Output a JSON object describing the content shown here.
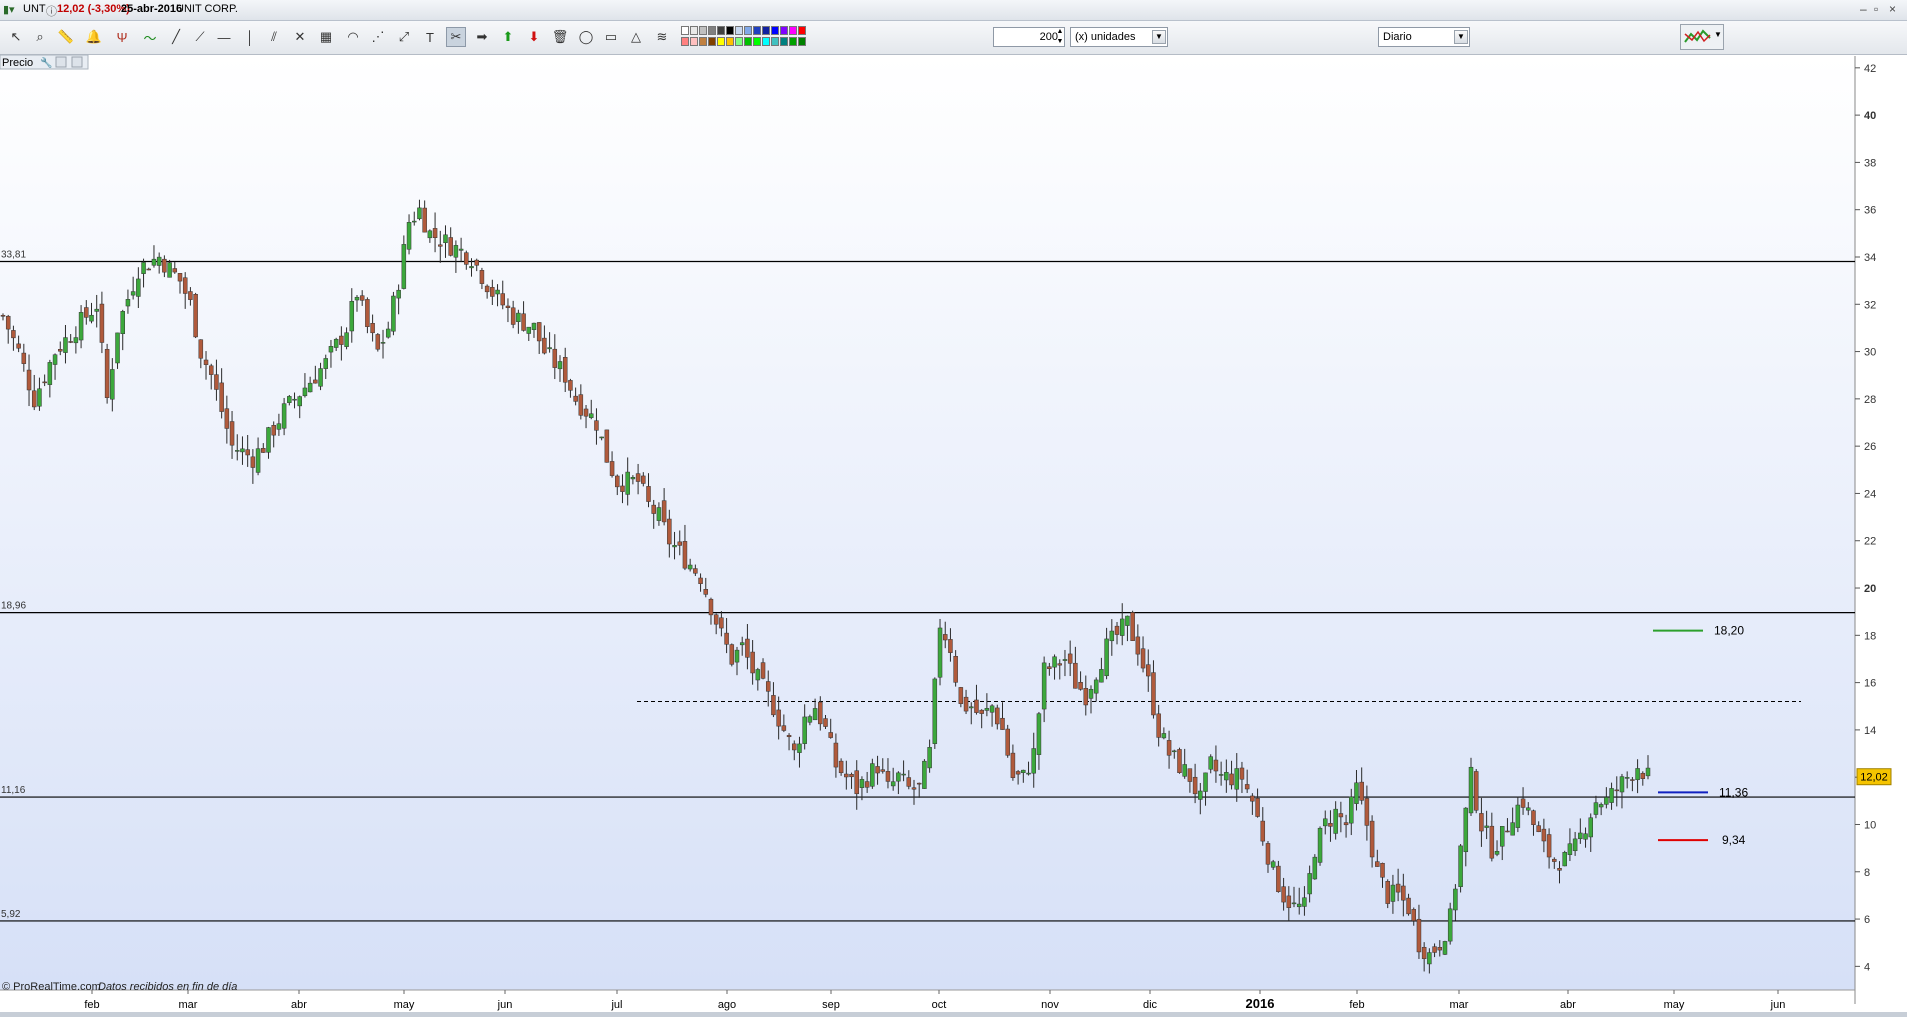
{
  "titlebar": {
    "symbol": "UNT",
    "price_change": "12,02 (-3,30%)",
    "date": "25-abr-2016",
    "company": "UNIT CORP."
  },
  "toolbar": {
    "units_value": "200",
    "units_label": "(x) unidades",
    "timeframe": "Diario",
    "tools": [
      "cursor-icon",
      "zoom-icon",
      "ruler-icon",
      "alarm-icon",
      "candles-icon",
      "line-chart-icon",
      "trendline-icon",
      "ray-icon",
      "hline-icon",
      "vline-icon",
      "channel-icon",
      "gann-icon",
      "fibonacci-icon",
      "arc-icon",
      "fan-icon",
      "extension-icon",
      "text-icon",
      "tools-icon",
      "arrow-right-icon",
      "arrow-up-icon",
      "arrow-down-icon",
      "trash-icon",
      "ellipse-icon",
      "rectangle-icon",
      "triangle-icon",
      "pattern-icon"
    ],
    "swatch_colors": [
      "#ffffff",
      "#e8e8e8",
      "#c0c0c0",
      "#808080",
      "#404040",
      "#000000",
      "#c8d8f0",
      "#80a8e8",
      "#2040c0",
      "#1020a0",
      "#0000ff",
      "#8000ff",
      "#ff00ff",
      "#ff0000",
      "#ff8080",
      "#ffc0c0",
      "#c08040",
      "#804000",
      "#ffff00",
      "#ffc000",
      "#80ff80",
      "#00c000",
      "#00ff00",
      "#00ffff",
      "#40c0c0",
      "#008080",
      "#00a000",
      "#008000"
    ]
  },
  "panel": {
    "label": "Precio"
  },
  "footer": {
    "copyright": "© ProRealTime.com",
    "note": "Datos recibidos en fin de día"
  },
  "colors": {
    "up": "#3ca83c",
    "down": "#b05a3c",
    "bg_top": "#ffffff",
    "bg_bottom": "#d6e0f7"
  },
  "chart_data": {
    "type": "candlestick",
    "symbol": "UNT",
    "y_axis": {
      "min": 3,
      "max": 42.5,
      "ticks": [
        4,
        6,
        8,
        10,
        12,
        14,
        16,
        18,
        20,
        22,
        24,
        26,
        28,
        30,
        32,
        34,
        36,
        38,
        40,
        42
      ],
      "side": "right"
    },
    "x_axis": {
      "labels": [
        "feb",
        "mar",
        "abr",
        "may",
        "jun",
        "jul",
        "ago",
        "sep",
        "oct",
        "nov",
        "dic",
        "2016",
        "feb",
        "mar",
        "abr",
        "may",
        "jun"
      ],
      "bold_labels": [
        "2016"
      ]
    },
    "last_price": "12,02",
    "horizontal_lines": [
      {
        "label": "33,81",
        "value": 33.81,
        "style": "solid",
        "color": "#000000"
      },
      {
        "label": "18,96",
        "value": 18.96,
        "style": "solid",
        "color": "#000000"
      },
      {
        "label": "11,16",
        "value": 11.16,
        "style": "solid",
        "color": "#000000"
      },
      {
        "label": "5,92",
        "value": 5.92,
        "style": "solid",
        "color": "#000000"
      },
      {
        "value": 15.2,
        "style": "dashed",
        "color": "#000000"
      }
    ],
    "target_levels": [
      {
        "label": "18,20",
        "value": 18.2,
        "color": "#2ca02c"
      },
      {
        "label": "11,36",
        "value": 11.36,
        "color": "#1020c0"
      },
      {
        "label": "9,34",
        "value": 9.34,
        "color": "#e00000"
      }
    ],
    "close_path": [
      [
        0,
        31.5
      ],
      [
        3,
        30
      ],
      [
        6,
        28
      ],
      [
        10,
        30
      ],
      [
        14,
        31
      ],
      [
        18,
        32
      ],
      [
        20,
        28
      ],
      [
        22,
        31
      ],
      [
        26,
        33.5
      ],
      [
        30,
        34
      ],
      [
        34,
        33
      ],
      [
        36,
        32
      ],
      [
        38,
        30
      ],
      [
        40,
        29
      ],
      [
        44,
        26
      ],
      [
        48,
        25.5
      ],
      [
        50,
        26
      ],
      [
        54,
        27.5
      ],
      [
        58,
        28.5
      ],
      [
        62,
        29.5
      ],
      [
        66,
        31
      ],
      [
        68,
        32.5
      ],
      [
        70,
        31
      ],
      [
        72,
        30
      ],
      [
        74,
        31
      ],
      [
        76,
        33
      ],
      [
        78,
        35.5
      ],
      [
        80,
        36
      ],
      [
        82,
        35
      ],
      [
        86,
        34.5
      ],
      [
        90,
        34
      ],
      [
        94,
        32.5
      ],
      [
        98,
        31.5
      ],
      [
        102,
        31
      ],
      [
        104,
        30
      ],
      [
        108,
        29
      ],
      [
        110,
        28
      ],
      [
        114,
        27
      ],
      [
        116,
        25.5
      ],
      [
        118,
        24.5
      ],
      [
        122,
        24.5
      ],
      [
        124,
        23.5
      ],
      [
        126,
        23
      ],
      [
        128,
        22
      ],
      [
        132,
        21
      ],
      [
        134,
        20.5
      ],
      [
        138,
        18
      ],
      [
        140,
        17
      ],
      [
        142,
        17.5
      ],
      [
        144,
        16.5
      ],
      [
        148,
        15
      ],
      [
        152,
        13
      ],
      [
        154,
        14.5
      ],
      [
        156,
        15
      ],
      [
        158,
        14
      ],
      [
        160,
        12.5
      ],
      [
        164,
        11.5
      ],
      [
        166,
        12
      ],
      [
        168,
        12.5
      ],
      [
        170,
        11.5
      ],
      [
        172,
        12
      ],
      [
        174,
        11.5
      ],
      [
        176,
        11.5
      ],
      [
        178,
        13
      ],
      [
        180,
        18.5
      ],
      [
        182,
        17.5
      ],
      [
        184,
        15
      ],
      [
        186,
        15
      ],
      [
        188,
        14.5
      ],
      [
        190,
        15
      ],
      [
        192,
        14
      ],
      [
        194,
        12
      ],
      [
        196,
        12
      ],
      [
        198,
        13
      ],
      [
        200,
        16.5
      ],
      [
        204,
        17
      ],
      [
        206,
        16
      ],
      [
        208,
        15.5
      ],
      [
        210,
        16.5
      ],
      [
        212,
        17.5
      ],
      [
        214,
        18
      ],
      [
        216,
        18.5
      ],
      [
        218,
        17.5
      ],
      [
        220,
        16
      ],
      [
        222,
        14
      ],
      [
        224,
        13
      ],
      [
        226,
        12.5
      ],
      [
        228,
        12
      ],
      [
        230,
        11
      ],
      [
        232,
        12.5
      ],
      [
        234,
        12
      ],
      [
        238,
        12
      ],
      [
        240,
        11
      ],
      [
        242,
        9.5
      ],
      [
        244,
        8
      ],
      [
        246,
        7
      ],
      [
        248,
        6.5
      ],
      [
        250,
        6.5
      ],
      [
        252,
        9
      ],
      [
        254,
        10
      ],
      [
        256,
        10.5
      ],
      [
        258,
        10
      ],
      [
        260,
        11.5
      ],
      [
        262,
        10
      ],
      [
        264,
        8
      ],
      [
        266,
        7
      ],
      [
        268,
        7
      ],
      [
        270,
        6.5
      ],
      [
        272,
        5
      ],
      [
        274,
        4.5
      ],
      [
        276,
        5
      ],
      [
        278,
        6
      ],
      [
        280,
        9
      ],
      [
        282,
        12
      ],
      [
        284,
        10
      ],
      [
        286,
        9
      ],
      [
        288,
        9.5
      ],
      [
        290,
        10.5
      ],
      [
        292,
        11
      ],
      [
        294,
        10
      ],
      [
        296,
        9
      ],
      [
        298,
        8.5
      ],
      [
        300,
        8.5
      ],
      [
        302,
        9
      ],
      [
        304,
        10
      ],
      [
        306,
        11
      ],
      [
        308,
        11
      ],
      [
        310,
        11.5
      ],
      [
        312,
        12
      ],
      [
        314,
        12.5
      ],
      [
        316,
        12.02
      ]
    ]
  }
}
